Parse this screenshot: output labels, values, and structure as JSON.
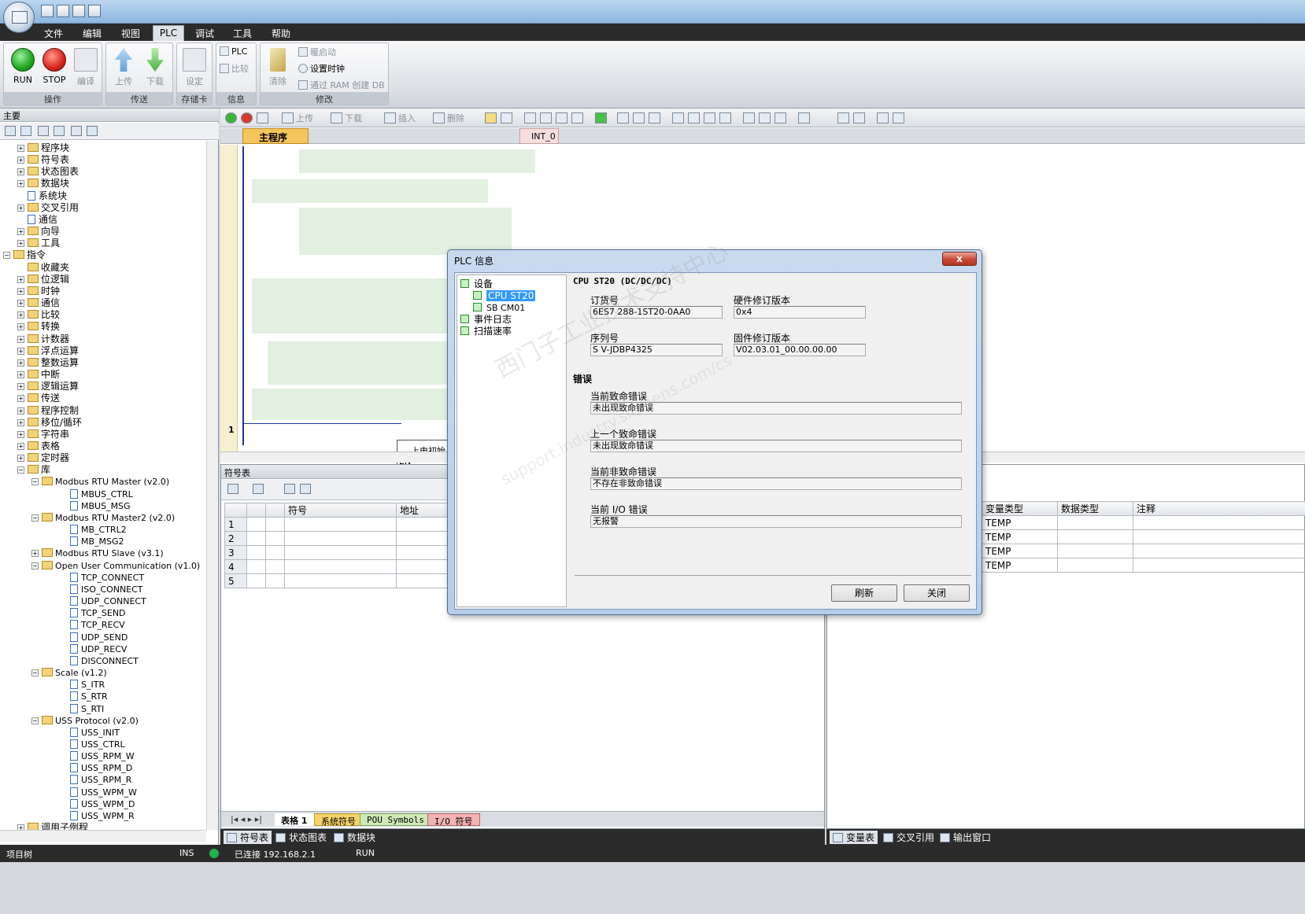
{
  "ribbon_tabs": [
    "文件",
    "编辑",
    "视图",
    "PLC",
    "调试",
    "工具",
    "帮助"
  ],
  "ribbon": {
    "groups": [
      "操作",
      "传送",
      "存储卡",
      "信息",
      "修改"
    ],
    "run": "RUN",
    "stop": "STOP",
    "compile": "编译",
    "upload": "上传",
    "download": "下载",
    "set": "设定",
    "plc": "PLC",
    "compare": "比较",
    "clear": "清除",
    "warm_start": "暖启动",
    "set_clock": "设置时钟",
    "create_db": "通过 RAM 创建 DB"
  },
  "editor_toolbar": {
    "upload": "上传",
    "download": "下载",
    "insert": "插入",
    "delete": "删除"
  },
  "left_pane": {
    "header": "主要",
    "tree": [
      {
        "label": "程序块",
        "level": 0,
        "kind": "folder",
        "expand": "+"
      },
      {
        "label": "符号表",
        "level": 0,
        "kind": "folder",
        "expand": "+"
      },
      {
        "label": "状态图表",
        "level": 0,
        "kind": "folder",
        "expand": "+"
      },
      {
        "label": "数据块",
        "level": 0,
        "kind": "folder",
        "expand": "+"
      },
      {
        "label": "系统块",
        "level": 0,
        "kind": "doc",
        "expand": ""
      },
      {
        "label": "交叉引用",
        "level": 0,
        "kind": "folder",
        "expand": "+"
      },
      {
        "label": "通信",
        "level": 0,
        "kind": "doc",
        "expand": ""
      },
      {
        "label": "向导",
        "level": 0,
        "kind": "folder",
        "expand": "+"
      },
      {
        "label": "工具",
        "level": 0,
        "kind": "folder",
        "expand": "+"
      },
      {
        "label": "指令",
        "level": -1,
        "kind": "folder",
        "expand": "-"
      },
      {
        "label": "收藏夹",
        "level": 0,
        "kind": "folder",
        "expand": ""
      },
      {
        "label": "位逻辑",
        "level": 0,
        "kind": "folder",
        "expand": "+"
      },
      {
        "label": "时钟",
        "level": 0,
        "kind": "folder",
        "expand": "+"
      },
      {
        "label": "通信",
        "level": 0,
        "kind": "folder",
        "expand": "+"
      },
      {
        "label": "比较",
        "level": 0,
        "kind": "folder",
        "expand": "+"
      },
      {
        "label": "转换",
        "level": 0,
        "kind": "folder",
        "expand": "+"
      },
      {
        "label": "计数器",
        "level": 0,
        "kind": "folder",
        "expand": "+"
      },
      {
        "label": "浮点运算",
        "level": 0,
        "kind": "folder",
        "expand": "+"
      },
      {
        "label": "整数运算",
        "level": 0,
        "kind": "folder",
        "expand": "+"
      },
      {
        "label": "中断",
        "level": 0,
        "kind": "folder",
        "expand": "+"
      },
      {
        "label": "逻辑运算",
        "level": 0,
        "kind": "folder",
        "expand": "+"
      },
      {
        "label": "传送",
        "level": 0,
        "kind": "folder",
        "expand": "+"
      },
      {
        "label": "程序控制",
        "level": 0,
        "kind": "folder",
        "expand": "+"
      },
      {
        "label": "移位/循环",
        "level": 0,
        "kind": "folder",
        "expand": "+"
      },
      {
        "label": "字符串",
        "level": 0,
        "kind": "folder",
        "expand": "+"
      },
      {
        "label": "表格",
        "level": 0,
        "kind": "folder",
        "expand": "+"
      },
      {
        "label": "定时器",
        "level": 0,
        "kind": "folder",
        "expand": "+"
      },
      {
        "label": "库",
        "level": 0,
        "kind": "folder",
        "expand": "-"
      },
      {
        "label": "Modbus RTU Master (v2.0)",
        "level": 1,
        "kind": "folder",
        "expand": "-"
      },
      {
        "label": "MBUS_CTRL",
        "level": 2,
        "kind": "doc",
        "expand": ""
      },
      {
        "label": "MBUS_MSG",
        "level": 2,
        "kind": "doc",
        "expand": ""
      },
      {
        "label": "Modbus RTU Master2 (v2.0)",
        "level": 1,
        "kind": "folder",
        "expand": "-"
      },
      {
        "label": "MB_CTRL2",
        "level": 2,
        "kind": "doc",
        "expand": ""
      },
      {
        "label": "MB_MSG2",
        "level": 2,
        "kind": "doc",
        "expand": ""
      },
      {
        "label": "Modbus RTU Slave (v3.1)",
        "level": 1,
        "kind": "folder",
        "expand": "+"
      },
      {
        "label": "Open User Communication (v1.0)",
        "level": 1,
        "kind": "folder",
        "expand": "-"
      },
      {
        "label": "TCP_CONNECT",
        "level": 2,
        "kind": "doc",
        "expand": ""
      },
      {
        "label": "ISO_CONNECT",
        "level": 2,
        "kind": "doc",
        "expand": ""
      },
      {
        "label": "UDP_CONNECT",
        "level": 2,
        "kind": "doc",
        "expand": ""
      },
      {
        "label": "TCP_SEND",
        "level": 2,
        "kind": "doc",
        "expand": ""
      },
      {
        "label": "TCP_RECV",
        "level": 2,
        "kind": "doc",
        "expand": ""
      },
      {
        "label": "UDP_SEND",
        "level": 2,
        "kind": "doc",
        "expand": ""
      },
      {
        "label": "UDP_RECV",
        "level": 2,
        "kind": "doc",
        "expand": ""
      },
      {
        "label": "DISCONNECT",
        "level": 2,
        "kind": "doc",
        "expand": ""
      },
      {
        "label": "Scale (v1.2)",
        "level": 1,
        "kind": "folder",
        "expand": "-"
      },
      {
        "label": "S_ITR",
        "level": 2,
        "kind": "doc",
        "expand": ""
      },
      {
        "label": "S_RTR",
        "level": 2,
        "kind": "doc",
        "expand": ""
      },
      {
        "label": "S_RTI",
        "level": 2,
        "kind": "doc",
        "expand": ""
      },
      {
        "label": "USS Protocol (v2.0)",
        "level": 1,
        "kind": "folder",
        "expand": "-"
      },
      {
        "label": "USS_INIT",
        "level": 2,
        "kind": "doc",
        "expand": ""
      },
      {
        "label": "USS_CTRL",
        "level": 2,
        "kind": "doc",
        "expand": ""
      },
      {
        "label": "USS_RPM_W",
        "level": 2,
        "kind": "doc",
        "expand": ""
      },
      {
        "label": "USS_RPM_D",
        "level": 2,
        "kind": "doc",
        "expand": ""
      },
      {
        "label": "USS_RPM_R",
        "level": 2,
        "kind": "doc",
        "expand": ""
      },
      {
        "label": "USS_WPM_W",
        "level": 2,
        "kind": "doc",
        "expand": ""
      },
      {
        "label": "USS_WPM_D",
        "level": 2,
        "kind": "doc",
        "expand": ""
      },
      {
        "label": "USS_WPM_R",
        "level": 2,
        "kind": "doc",
        "expand": ""
      },
      {
        "label": "调用子例程",
        "level": 0,
        "kind": "folder",
        "expand": "+"
      }
    ]
  },
  "editor": {
    "main_tab": "主程序",
    "int_tab": "INT_0",
    "rung_number": "1",
    "box_title": "上电初始",
    "en_label": "EN"
  },
  "symbol_pane": {
    "header": "符号表",
    "columns": [
      "符号",
      "地址"
    ],
    "rows": [
      "1",
      "2",
      "3",
      "4",
      "5"
    ],
    "sheet_tabs": {
      "table_label": "表格",
      "table_num": "1",
      "system": "系统符号",
      "pou": "POU Symbols",
      "io": "I/O 符号"
    }
  },
  "var_pane": {
    "columns": [
      "变量类型",
      "数据类型",
      "注释"
    ],
    "rows": [
      "TEMP",
      "TEMP",
      "TEMP",
      "TEMP"
    ]
  },
  "bottom_tabs_left": [
    "符号表",
    "状态图表",
    "数据块"
  ],
  "bottom_tabs_right": [
    "变量表",
    "交叉引用",
    "输出窗口"
  ],
  "status": {
    "project_tree": "项目树",
    "ins": "INS",
    "connection": "已连接 192.168.2.1",
    "mode": "RUN"
  },
  "dialog": {
    "title": "PLC 信息",
    "close": "x",
    "tree": {
      "device": "设备",
      "cpu": "CPU ST20",
      "sb": "SB CM01",
      "event_log": "事件日志",
      "scan_rate": "扫描速率"
    },
    "heading": "CPU ST20 (DC/DC/DC)",
    "order_label": "订货号",
    "order_value": "6ES7 288-1ST20-0AA0",
    "hw_label": "硬件修订版本",
    "hw_value": "0x4",
    "serial_label": "序列号",
    "serial_value": "S V-JDBP4325",
    "fw_label": "固件修订版本",
    "fw_value": "V02.03.01_00.00.00.00",
    "errors_heading": "错误",
    "cur_fatal_label": "当前致命错误",
    "cur_fatal_value": "未出现致命错误",
    "last_fatal_label": "上一个致命错误",
    "last_fatal_value": "未出现致命错误",
    "cur_nonfatal_label": "当前非致命错误",
    "cur_nonfatal_value": "不存在非致命错误",
    "cur_io_label": "当前 I/O 错误",
    "cur_io_value": "无报警",
    "refresh": "刷新",
    "close_btn": "关闭"
  },
  "watermark": "西门子工业技术支持中心",
  "watermark2": "support.industry.siemens.com/cs",
  "colors": {
    "accent": "#3399ff",
    "dark_bar": "#2b2b2b",
    "tab_orange": "#f4c55a",
    "connected": "#22b14c"
  }
}
